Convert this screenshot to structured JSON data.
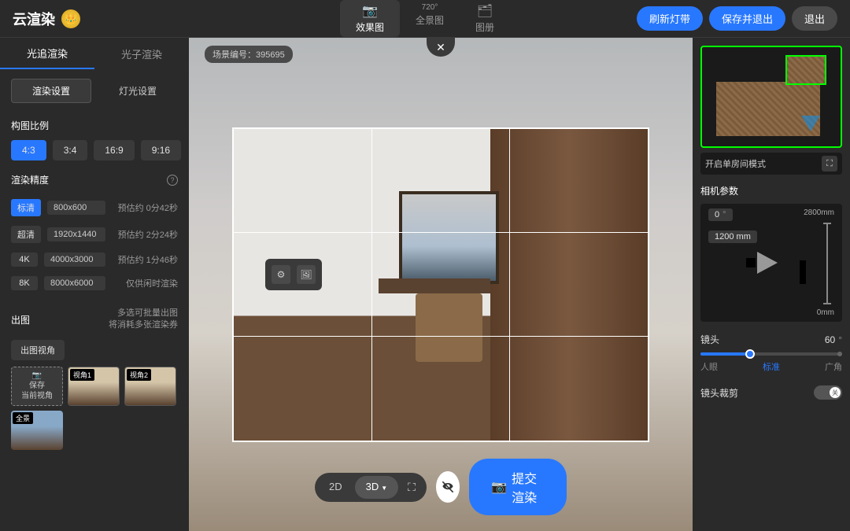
{
  "header": {
    "logo": "云渲染",
    "tabs": [
      {
        "label": "效果图",
        "icon": "📷",
        "active": true
      },
      {
        "label": "全景图",
        "icon": "720°",
        "active": false
      },
      {
        "label": "图册",
        "icon": "🗂",
        "active": false
      }
    ],
    "refresh_btn": "刷新灯带",
    "save_exit_btn": "保存并退出",
    "exit_btn": "退出"
  },
  "sidebar": {
    "render_tabs": [
      {
        "label": "光追渲染",
        "active": true
      },
      {
        "label": "光子渲染",
        "active": false
      }
    ],
    "sub_tabs": [
      {
        "label": "渲染设置",
        "active": true
      },
      {
        "label": "灯光设置",
        "active": false
      }
    ],
    "ratio": {
      "title": "构图比例",
      "options": [
        {
          "label": "4:3",
          "active": true
        },
        {
          "label": "3:4",
          "active": false
        },
        {
          "label": "16:9",
          "active": false
        },
        {
          "label": "9:16",
          "active": false
        }
      ]
    },
    "resolution": {
      "title": "渲染精度",
      "rows": [
        {
          "badge": "标清",
          "size": "800x600",
          "time": "预估约 0分42秒",
          "active": true
        },
        {
          "badge": "超清",
          "size": "1920x1440",
          "time": "预估约 2分24秒",
          "active": false
        },
        {
          "badge": "4K",
          "size": "4000x3000",
          "time": "预估约 1分46秒",
          "active": false
        },
        {
          "badge": "8K",
          "size": "8000x6000",
          "time": "仅供闲时渲染",
          "active": false
        }
      ]
    },
    "output": {
      "title": "出图",
      "note_line1": "多选可批量出图",
      "note_line2": "将消耗多张渲染券",
      "export_btn": "出图视角",
      "save_current": "保存\n当前视角",
      "angles": [
        {
          "label": "视角1"
        },
        {
          "label": "视角2"
        }
      ],
      "panorama": "全景"
    }
  },
  "viewport": {
    "scene_id": "场景编号：395695",
    "view_2d": "2D",
    "view_3d": "3D",
    "submit": "提交渲染"
  },
  "right": {
    "minimap_mode": "开启单房间模式",
    "cam_section": "相机参数",
    "cam_angle": "0",
    "cam_angle_unit": "°",
    "cam_max": "2800mm",
    "cam_min": "0mm",
    "cam_height": "1200 mm",
    "lens_label": "镜头",
    "lens_value": "60",
    "lens_unit": "°",
    "slider_labels": [
      "人眼",
      "标准",
      "广角"
    ],
    "crop_label": "镜头裁剪",
    "crop_state": "关"
  }
}
